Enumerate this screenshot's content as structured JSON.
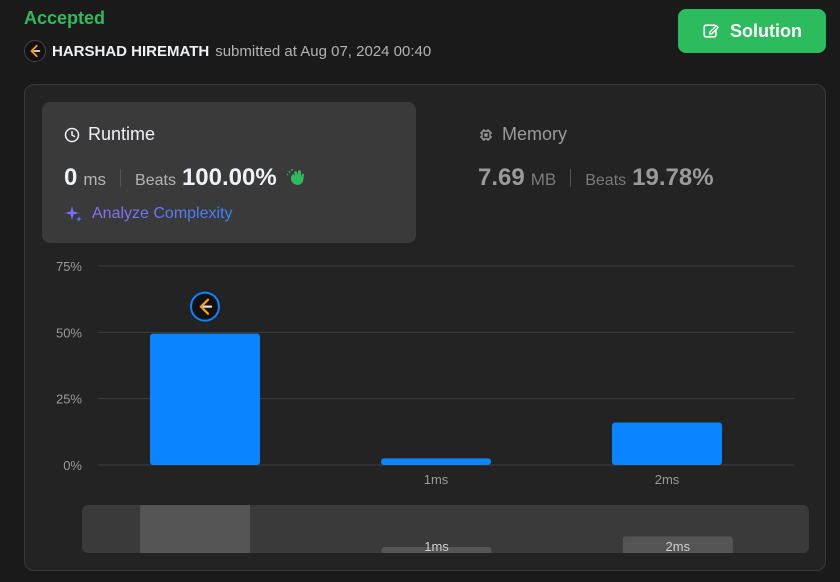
{
  "header": {
    "status": "Accepted",
    "user_name": "HARSHAD HIREMATH",
    "submitted_text": "submitted at Aug 07, 2024 00:40",
    "solution_label": "Solution"
  },
  "runtime": {
    "title": "Runtime",
    "value": "0",
    "unit": "ms",
    "beats_label": "Beats",
    "beats_value": "100.00%",
    "analyze_label": "Analyze Complexity"
  },
  "memory": {
    "title": "Memory",
    "value": "7.69",
    "unit": "MB",
    "beats_label": "Beats",
    "beats_value": "19.78%"
  },
  "colors": {
    "accent_green": "#2cbb5d",
    "bar_blue": "#0a84ff",
    "minimap_bar": "#555555"
  },
  "chart_data": {
    "type": "bar",
    "categories": [
      "0ms",
      "1ms",
      "2ms"
    ],
    "category_labels": [
      "",
      "1ms",
      "2ms"
    ],
    "values": [
      49.5,
      2.5,
      16.0
    ],
    "ylim": [
      0,
      75
    ],
    "yticks": [
      0,
      25,
      50,
      75
    ],
    "ytick_labels": [
      "0%",
      "25%",
      "50%",
      "75%"
    ],
    "grid": true,
    "highlight_index": 0,
    "highlight_icon": "leetcode-icon"
  }
}
